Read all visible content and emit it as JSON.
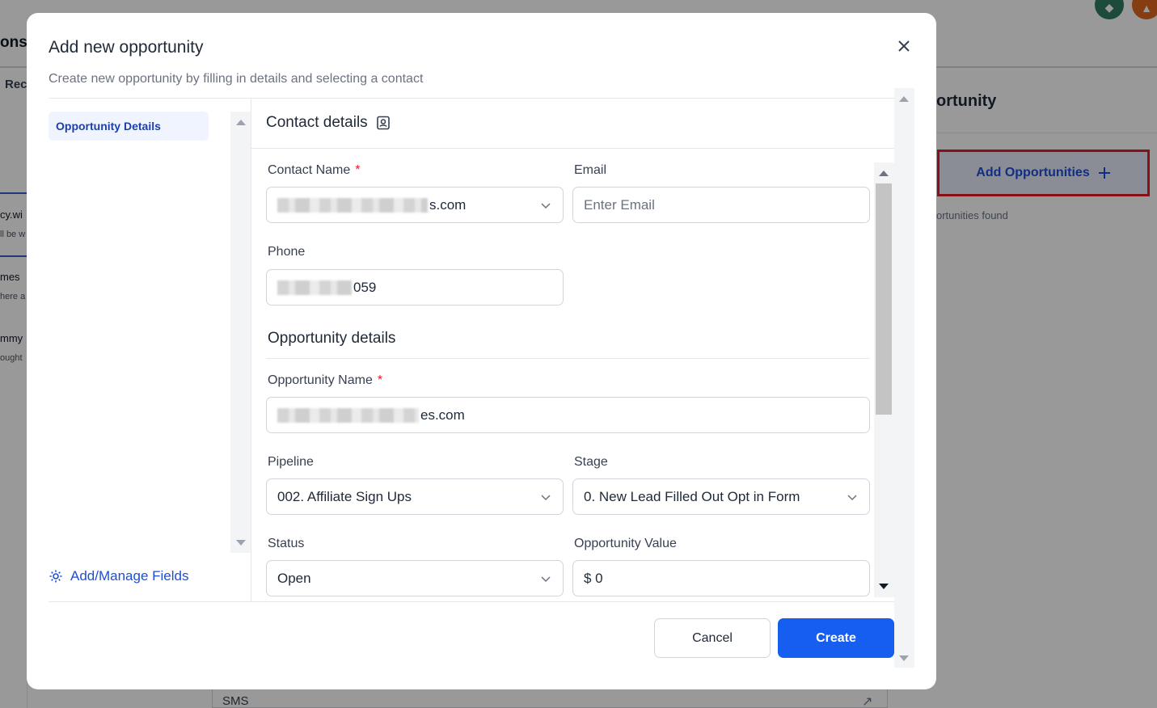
{
  "background": {
    "page_title_fragment": "ons",
    "tab_fragment": "Rec",
    "list_items": [
      {
        "name": "cy.wi",
        "sub": "ll be w"
      },
      {
        "name": "mes",
        "sub": "here a"
      },
      {
        "name": "mmy",
        "sub": "ought"
      }
    ],
    "right_panel_title_fragment": "ortunity",
    "add_opportunities_label": "Add Opportunities",
    "add_icon": "plus-icon",
    "found_fragment": "ortunities found",
    "sms_label": "SMS",
    "colors": {
      "highlight_outline": "#e11d2a",
      "accent": "#1d4ed8"
    }
  },
  "modal": {
    "title": "Add new opportunity",
    "subtitle": "Create new opportunity by filling in details and selecting a contact",
    "nav": [
      {
        "label": "Opportunity Details",
        "active": true
      }
    ],
    "manage_fields_label": "Add/Manage Fields",
    "contact_section": {
      "title": "Contact details",
      "contact_name": {
        "label": "Contact Name",
        "required_mark": "*",
        "value_suffix": "s.com"
      },
      "email": {
        "label": "Email",
        "placeholder": "Enter Email"
      },
      "phone": {
        "label": "Phone",
        "value_suffix": "059"
      }
    },
    "opportunity_section": {
      "title": "Opportunity details",
      "opportunity_name": {
        "label": "Opportunity Name",
        "required_mark": "*",
        "value_suffix": "es.com"
      },
      "pipeline": {
        "label": "Pipeline",
        "value": "002. Affiliate Sign Ups"
      },
      "stage": {
        "label": "Stage",
        "value": "0. New Lead Filled Out Opt in Form"
      },
      "status": {
        "label": "Status",
        "value": "Open"
      },
      "opportunity_value": {
        "label": "Opportunity Value",
        "value": "$ 0"
      }
    },
    "buttons": {
      "cancel": "Cancel",
      "create": "Create"
    },
    "colors": {
      "primary": "#155eef",
      "required": "#e11d2a"
    }
  }
}
